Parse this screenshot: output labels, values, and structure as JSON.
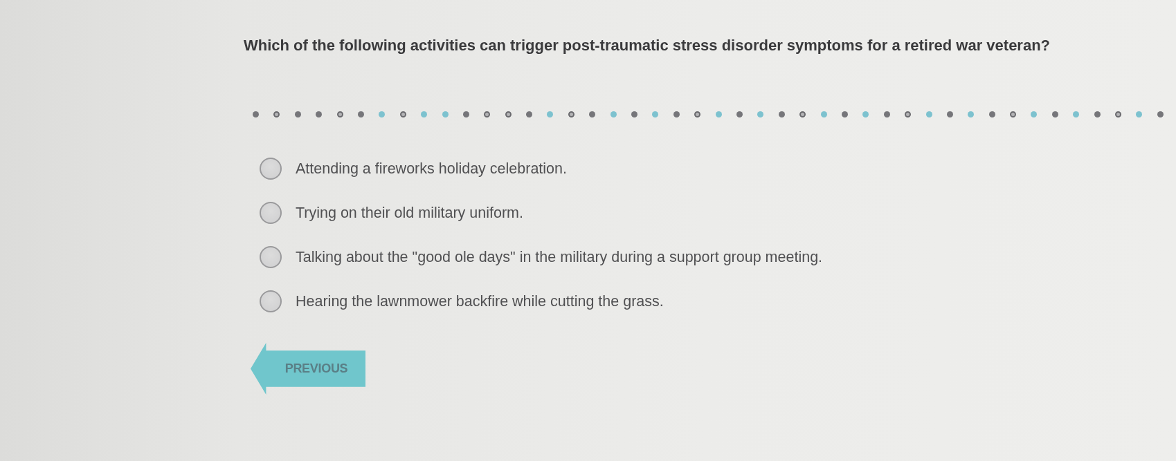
{
  "question": "Which of the following activities can trigger post-traumatic stress disorder symptoms for a retired war veteran?",
  "progress_dots": [
    {
      "kind": "solid",
      "color": "#76767a"
    },
    {
      "kind": "ring",
      "color": "#6a6a6e"
    },
    {
      "kind": "solid",
      "color": "#76767a"
    },
    {
      "kind": "solid",
      "color": "#76767a"
    },
    {
      "kind": "ring",
      "color": "#6a6a6e"
    },
    {
      "kind": "solid",
      "color": "#76767a"
    },
    {
      "kind": "solid",
      "color": "#7dc2cf"
    },
    {
      "kind": "ring",
      "color": "#6a6a6e"
    },
    {
      "kind": "solid",
      "color": "#7dc2cf"
    },
    {
      "kind": "solid",
      "color": "#7dc2cf"
    },
    {
      "kind": "solid",
      "color": "#76767a"
    },
    {
      "kind": "ring",
      "color": "#6a6a6e"
    },
    {
      "kind": "ring",
      "color": "#6a6a6e"
    },
    {
      "kind": "solid",
      "color": "#76767a"
    },
    {
      "kind": "solid",
      "color": "#7dc2cf"
    },
    {
      "kind": "ring",
      "color": "#6a6a6e"
    },
    {
      "kind": "solid",
      "color": "#76767a"
    },
    {
      "kind": "solid",
      "color": "#7dc2cf"
    },
    {
      "kind": "solid",
      "color": "#76767a"
    },
    {
      "kind": "solid",
      "color": "#7dc2cf"
    },
    {
      "kind": "solid",
      "color": "#76767a"
    },
    {
      "kind": "ring",
      "color": "#6a6a6e"
    },
    {
      "kind": "solid",
      "color": "#7dc2cf"
    },
    {
      "kind": "solid",
      "color": "#76767a"
    },
    {
      "kind": "solid",
      "color": "#7dc2cf"
    },
    {
      "kind": "solid",
      "color": "#76767a"
    },
    {
      "kind": "ring",
      "color": "#6a6a6e"
    },
    {
      "kind": "solid",
      "color": "#7dc2cf"
    },
    {
      "kind": "solid",
      "color": "#76767a"
    },
    {
      "kind": "solid",
      "color": "#7dc2cf"
    },
    {
      "kind": "solid",
      "color": "#76767a"
    },
    {
      "kind": "ring",
      "color": "#6a6a6e"
    },
    {
      "kind": "solid",
      "color": "#7dc2cf"
    },
    {
      "kind": "solid",
      "color": "#76767a"
    },
    {
      "kind": "solid",
      "color": "#7dc2cf"
    },
    {
      "kind": "solid",
      "color": "#76767a"
    },
    {
      "kind": "ring",
      "color": "#6a6a6e"
    },
    {
      "kind": "solid",
      "color": "#7dc2cf"
    },
    {
      "kind": "solid",
      "color": "#76767a"
    },
    {
      "kind": "solid",
      "color": "#7dc2cf"
    },
    {
      "kind": "solid",
      "color": "#76767a"
    },
    {
      "kind": "ring",
      "color": "#6a6a6e"
    },
    {
      "kind": "solid",
      "color": "#7dc2cf"
    },
    {
      "kind": "solid",
      "color": "#76767a"
    }
  ],
  "options": [
    {
      "label": "Attending a fireworks holiday celebration.",
      "selected": false
    },
    {
      "label": "Trying on their old military uniform.",
      "selected": false
    },
    {
      "label": "Talking about the \"good ole days\" in the military during a support group meeting.",
      "selected": false
    },
    {
      "label": "Hearing the lawnmower backfire while cutting the grass.",
      "selected": false
    }
  ],
  "previous_button": {
    "label": "PREVIOUS"
  }
}
